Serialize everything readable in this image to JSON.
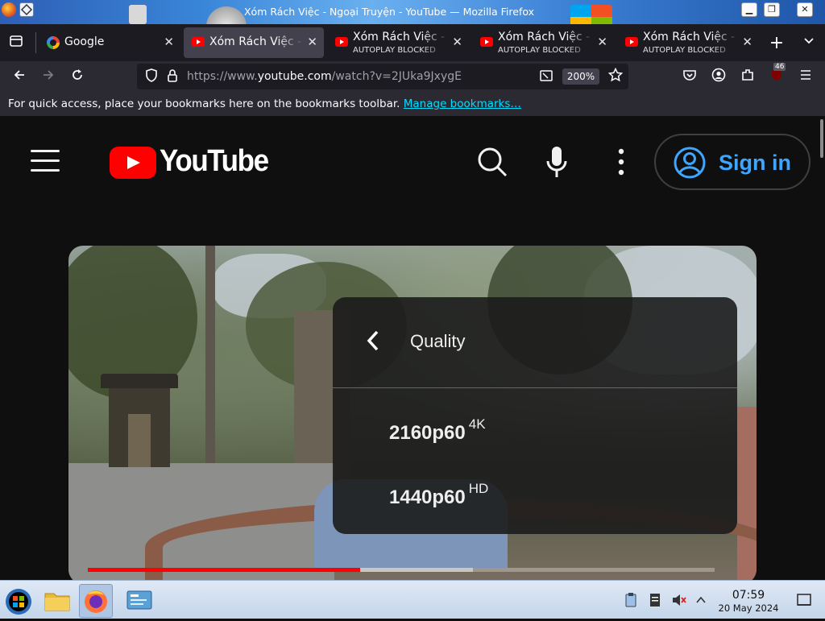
{
  "window": {
    "title": "Xóm Rách Việc - Ngoại Truyện - YouTube — Mozilla Firefox"
  },
  "tabs": [
    {
      "label": "Google",
      "sublabel": "",
      "favicon": "google-icon",
      "active": false
    },
    {
      "label": "Xóm Rách Việc - N",
      "sublabel": "",
      "favicon": "youtube-icon",
      "active": true
    },
    {
      "label": "Xóm Rách Việc - N",
      "sublabel": "AUTOPLAY BLOCKED",
      "favicon": "youtube-icon",
      "active": false
    },
    {
      "label": "Xóm Rách Việc - N",
      "sublabel": "AUTOPLAY BLOCKED",
      "favicon": "youtube-icon",
      "active": false
    },
    {
      "label": "Xóm Rách Việc - N",
      "sublabel": "AUTOPLAY BLOCKED",
      "favicon": "youtube-icon",
      "active": false
    }
  ],
  "navbar": {
    "url_prefix": "https://www.",
    "url_domain": "youtube.com",
    "url_path": "/watch?v=2JUka9JxygE",
    "zoom": "200%",
    "extension_badge": "46"
  },
  "bookmarks": {
    "message": "For quick access, place your bookmarks here on the bookmarks toolbar.",
    "link": "Manage bookmarks…"
  },
  "youtube": {
    "logo_text": "YouTube",
    "signin_label": "Sign in",
    "brand_color": "#ff0000",
    "accent_color": "#3ea6ff"
  },
  "player": {
    "progress_fraction": 0.435,
    "buffered_fraction": 0.615
  },
  "quality_menu": {
    "title": "Quality",
    "options": [
      {
        "label": "2160p60",
        "badge": "4K"
      },
      {
        "label": "1440p60",
        "badge": "HD"
      }
    ]
  },
  "taskbar": {
    "time": "07:59",
    "date": "20 May 2024"
  }
}
